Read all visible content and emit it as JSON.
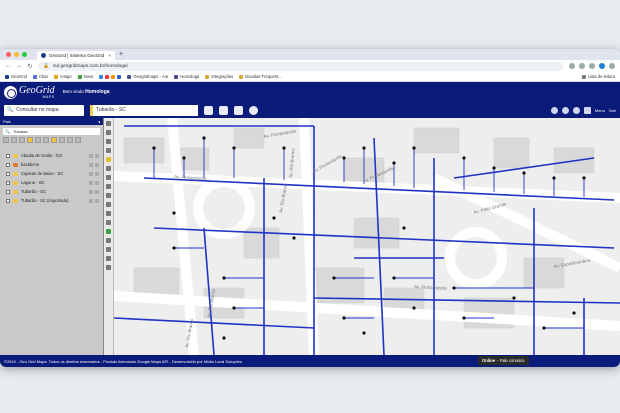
{
  "browser": {
    "tab_title": "GeoGrid | Sistema GeoGrid",
    "url": "sul.geogridmaps.com.br/homologa/"
  },
  "bookmarks": [
    "GeoGrid",
    "Chat",
    "Antigo",
    "Novo",
    "Geogridmaps - Aut",
    "Homologa",
    "Integrações",
    "Dúvidas Frequent..."
  ],
  "bookmarks_right": "Lista de leitura",
  "app": {
    "logo": "GeoGrid",
    "logo_sub": "MAPS",
    "welcome_prefix": "Bem vindo",
    "welcome_user": "Homologa",
    "search_placeholder": "Consultar no mapa",
    "city": "Tubarão - SC",
    "menu_label": "Menu",
    "sair_label": "Sair"
  },
  "sidebar": {
    "title": "Pais",
    "filter": "Tubarao",
    "layers": [
      "Abadia de Goiás - GO",
      "backbone",
      "Capivari de Baixo - SC",
      "Laguna - SC",
      "Tubarão - SC",
      "Tubarão - SC (importado)"
    ]
  },
  "map": {
    "streets": [
      "Av. Rio Branco",
      "Av. Rio Branco",
      "Av. Rio Branco",
      "Av. Rio Branco",
      "Av. Florianópolis",
      "Av. Florianópolis",
      "Av. Florianópolis",
      "Av. Florianópolis",
      "Av. Expedicionário",
      "Av. Pátio Grande",
      "Av. Florianópolis"
    ]
  },
  "status": {
    "copyright": "©2010 - Geo Grid Maps. Todos os direitos reservados - Produto licenciado Google Maps API - Desenvolvido por Mídia Local Soluções",
    "online": "Online",
    "online_sub": "- Fale conosco"
  }
}
